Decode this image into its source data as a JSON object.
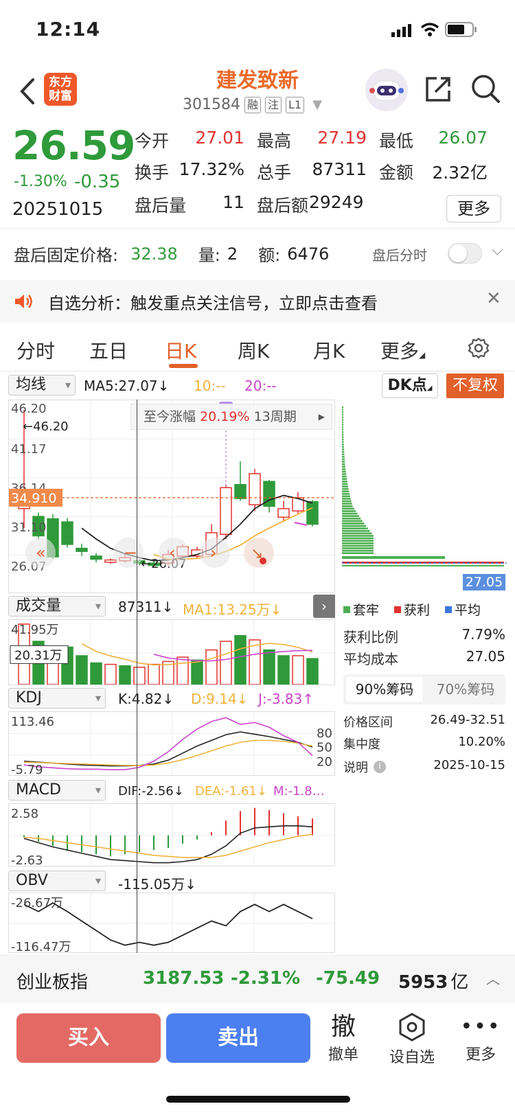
{
  "status": {
    "time": "12:14"
  },
  "header": {
    "logo_line1": "东方",
    "logo_line2": "财富",
    "stock_name": "建发致新",
    "stock_code": "301584",
    "tags": [
      "融",
      "注",
      "L1"
    ]
  },
  "quote": {
    "price": "26.59",
    "change_pct": "-1.30%",
    "change": "-0.35",
    "date": "20251015",
    "open_label": "今开",
    "open": "27.01",
    "high_label": "最高",
    "high": "27.19",
    "low_label": "最低",
    "low": "26.07",
    "turnover_label": "换手",
    "turnover": "17.32%",
    "volume_label": "总手",
    "volume": "87311",
    "amount_label": "金额",
    "amount": "2.32亿",
    "ah_vol_label": "盘后量",
    "ah_vol": "11",
    "ah_amt_label": "盘后额",
    "ah_amt": "29249",
    "more_label": "更多"
  },
  "after_hours": {
    "fixed_label": "盘后固定价格:",
    "fixed_price": "32.38",
    "vol_label": "量:",
    "vol": "2",
    "amt_label": "额:",
    "amt": "6476",
    "toggle_label": "盘后分时"
  },
  "notice": {
    "text": "自选分析：触发重点关注信号，立即点击查看"
  },
  "tabs": [
    "分时",
    "五日",
    "日K",
    "周K",
    "月K",
    "更多"
  ],
  "kline": {
    "ma_select": "均线",
    "ma5": "MA5:27.07",
    "ma10": "10:--",
    "ma20": "20:--",
    "dk_btn": "DK点",
    "fq_btn": "不复权",
    "price_ticks": [
      "46.20",
      "41.17",
      "36.14",
      "31.10",
      "26.07"
    ],
    "high_mark": "46.20",
    "low_mark": "26.07",
    "crosshair_price": "34.910",
    "period_label": "至今涨幅",
    "period_pct": "20.19%",
    "period_count": "13周期",
    "self_mark": "自",
    "colors": {
      "up": "#e2332f",
      "down": "#2f9a3a",
      "ma5": "#222222",
      "ma10": "#f0b23c",
      "ma20": "#cc44cc"
    }
  },
  "chart_data": {
    "type": "candlestick",
    "ylim": [
      26.07,
      46.2
    ],
    "candles": [
      {
        "o": 33.5,
        "c": 35.0,
        "h": 46.2,
        "l": 31.0
      },
      {
        "o": 32.5,
        "c": 30.0,
        "h": 33.0,
        "l": 29.5
      },
      {
        "o": 32.2,
        "c": 27.3,
        "h": 32.8,
        "l": 27.0
      },
      {
        "o": 31.8,
        "c": 28.9,
        "h": 32.3,
        "l": 28.5
      },
      {
        "o": 28.4,
        "c": 28.0,
        "h": 29.0,
        "l": 27.4
      },
      {
        "o": 27.4,
        "c": 27.0,
        "h": 27.8,
        "l": 26.6
      },
      {
        "o": 26.6,
        "c": 26.9,
        "h": 27.1,
        "l": 26.4
      },
      {
        "o": 26.8,
        "c": 27.2,
        "h": 27.6,
        "l": 26.6
      },
      {
        "o": 26.8,
        "c": 26.5,
        "h": 27.0,
        "l": 26.2
      },
      {
        "o": 26.5,
        "c": 26.2,
        "h": 26.8,
        "l": 26.07
      },
      {
        "o": 26.5,
        "c": 27.6,
        "h": 28.2,
        "l": 26.2
      },
      {
        "o": 27.4,
        "c": 28.6,
        "h": 28.9,
        "l": 27.0
      },
      {
        "o": 27.4,
        "c": 28.2,
        "h": 28.6,
        "l": 27.2
      },
      {
        "o": 27.6,
        "c": 30.4,
        "h": 31.5,
        "l": 27.4
      },
      {
        "o": 30.2,
        "c": 36.2,
        "h": 36.6,
        "l": 29.6
      },
      {
        "o": 36.6,
        "c": 34.8,
        "h": 39.6,
        "l": 34.5
      },
      {
        "o": 34.0,
        "c": 38.0,
        "h": 38.6,
        "l": 33.2
      },
      {
        "o": 37.0,
        "c": 33.8,
        "h": 37.2,
        "l": 33.0
      },
      {
        "o": 32.4,
        "c": 33.5,
        "h": 34.5,
        "l": 31.8
      },
      {
        "o": 33.2,
        "c": 34.9,
        "h": 35.6,
        "l": 32.8
      },
      {
        "o": 34.4,
        "c": 31.5,
        "h": 34.6,
        "l": 31.2
      }
    ],
    "ma5": [
      null,
      null,
      null,
      null,
      31.0,
      29.6,
      28.4,
      27.7,
      27.2,
      26.8,
      26.9,
      27.2,
      27.6,
      28.3,
      29.8,
      31.5,
      33.5,
      34.6,
      35.2,
      34.8,
      34.2
    ],
    "ma10": [
      null,
      null,
      null,
      null,
      null,
      null,
      null,
      null,
      null,
      27.6,
      27.0,
      27.0,
      27.1,
      27.4,
      28.0,
      28.8,
      30.0,
      31.0,
      31.9,
      32.8,
      33.6
    ]
  },
  "volume": {
    "select": "成交量",
    "value": "87311",
    "ma1": "MA1:13.25万",
    "ticks": [
      "41.95万",
      "20.31万"
    ],
    "bars": [
      {
        "v": 41.95,
        "up": true
      },
      {
        "v": 30.0,
        "up": false
      },
      {
        "v": 24.0,
        "up": true
      },
      {
        "v": 26.0,
        "up": false
      },
      {
        "v": 20.0,
        "up": false
      },
      {
        "v": 15.0,
        "up": false
      },
      {
        "v": 14.0,
        "up": true
      },
      {
        "v": 13.0,
        "up": false
      },
      {
        "v": 12.0,
        "up": true
      },
      {
        "v": 14.0,
        "up": true
      },
      {
        "v": 16.0,
        "up": true
      },
      {
        "v": 19.0,
        "up": true
      },
      {
        "v": 17.0,
        "up": false
      },
      {
        "v": 24.0,
        "up": true
      },
      {
        "v": 30.0,
        "up": true
      },
      {
        "v": 34.0,
        "up": false
      },
      {
        "v": 31.0,
        "up": true
      },
      {
        "v": 24.0,
        "up": false
      },
      {
        "v": 20.0,
        "up": false
      },
      {
        "v": 20.0,
        "up": true
      },
      {
        "v": 18.0,
        "up": false
      }
    ]
  },
  "kdj": {
    "select": "KDJ",
    "k": "K:4.82",
    "d": "D:9.14",
    "j": "J:-3.83",
    "ticks": [
      "113.46",
      "-5.79"
    ],
    "levels": [
      "80",
      "50",
      "20"
    ],
    "k_line": [
      18,
      16,
      14,
      12,
      10,
      9,
      8,
      8,
      9,
      12,
      20,
      35,
      50,
      62,
      74,
      80,
      75,
      70,
      64,
      58,
      48
    ],
    "d_line": [
      16,
      15,
      14,
      13,
      12,
      11,
      10,
      9,
      9,
      10,
      14,
      21,
      30,
      40,
      50,
      58,
      62,
      62,
      60,
      56,
      50
    ],
    "j_line": [
      10,
      6,
      4,
      2,
      1,
      1,
      0,
      0,
      5,
      18,
      38,
      64,
      86,
      102,
      110,
      96,
      100,
      90,
      72,
      58,
      30
    ]
  },
  "macd": {
    "select": "MACD",
    "dif": "DIF:-2.56",
    "dea": "DEA:-1.61",
    "m": "M:-1.8…",
    "ticks": [
      "2.58",
      "-2.63"
    ],
    "dif_line": [
      -0.3,
      -0.7,
      -1.1,
      -1.4,
      -1.7,
      -2.0,
      -2.3,
      -2.4,
      -2.5,
      -2.6,
      -2.6,
      -2.5,
      -2.3,
      -1.8,
      -1.0,
      0.2,
      0.7,
      0.8,
      0.9,
      0.9,
      0.8
    ],
    "dea_line": [
      -0.2,
      -0.3,
      -0.5,
      -0.7,
      -0.9,
      -1.1,
      -1.3,
      -1.5,
      -1.7,
      -1.9,
      -2.0,
      -2.1,
      -2.1,
      -2.1,
      -1.9,
      -1.5,
      -1.1,
      -0.7,
      -0.4,
      -0.1,
      0.1
    ],
    "hist": [
      -0.2,
      -0.6,
      -1.0,
      -1.4,
      -1.6,
      -1.8,
      -2.0,
      -1.8,
      -1.6,
      -1.4,
      -1.2,
      -0.8,
      -0.4,
      0.3,
      1.4,
      2.3,
      2.6,
      2.4,
      2.1,
      1.8,
      1.6
    ]
  },
  "obv": {
    "select": "OBV",
    "value": "-115.05万",
    "ticks": [
      "-26.67万",
      "-116.47万"
    ],
    "line": [
      -30,
      -45,
      -27,
      -45,
      -65,
      -85,
      -105,
      -116,
      -110,
      -116,
      -110,
      -95,
      -80,
      -65,
      -75,
      -45,
      -30,
      -45,
      -30,
      -45,
      -60
    ]
  },
  "chip": {
    "price_label": "27.05",
    "legend_trapped": "套牢",
    "legend_profit": "获利",
    "legend_avg": "平均",
    "profit_ratio_label": "获利比例",
    "profit_ratio": "7.79%",
    "avg_cost_label": "平均成本",
    "avg_cost": "27.05",
    "tab_90": "90%筹码",
    "tab_70": "70%筹码",
    "range_label": "价格区间",
    "range": "26.49-32.51",
    "concentration_label": "集中度",
    "concentration": "10.20%",
    "note_label": "说明",
    "note_date": "2025-10-15",
    "colors": {
      "trapped": "#4caf50",
      "profit": "#e2332f",
      "avg": "#3a78e0"
    }
  },
  "index_bar": {
    "name": "创业板指",
    "value": "3187.53",
    "pct": "-2.31%",
    "change": "-75.49",
    "amount": "5953",
    "amount_unit": "亿"
  },
  "bottom": {
    "buy": "买入",
    "sell": "卖出",
    "cancel_glyph": "撤",
    "cancel": "撤单",
    "watch": "设自选",
    "more": "更多"
  }
}
